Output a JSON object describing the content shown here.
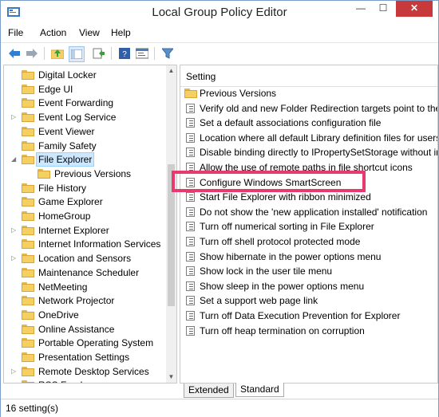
{
  "window": {
    "title": "Local Group Policy Editor",
    "minimize_glyph": "—",
    "maximize_glyph": "☐",
    "close_glyph": "✕"
  },
  "menu": [
    "File",
    "Action",
    "View",
    "Help"
  ],
  "toolbar": {
    "icons": [
      "back-arrow-icon",
      "forward-arrow-icon",
      "up-folder-icon",
      "show-hide-tree-icon",
      "export-list-icon",
      "help-icon",
      "properties-icon",
      "filter-icon"
    ]
  },
  "tree": {
    "items": [
      {
        "label": "Digital Locker",
        "expander": ""
      },
      {
        "label": "Edge UI",
        "expander": ""
      },
      {
        "label": "Event Forwarding",
        "expander": ""
      },
      {
        "label": "Event Log Service",
        "expander": "▷"
      },
      {
        "label": "Event Viewer",
        "expander": ""
      },
      {
        "label": "Family Safety",
        "expander": ""
      },
      {
        "label": "File Explorer",
        "expander": "◢",
        "selected": true
      },
      {
        "label": "Previous Versions",
        "expander": "",
        "indent": true
      },
      {
        "label": "File History",
        "expander": ""
      },
      {
        "label": "Game Explorer",
        "expander": ""
      },
      {
        "label": "HomeGroup",
        "expander": ""
      },
      {
        "label": "Internet Explorer",
        "expander": "▷"
      },
      {
        "label": "Internet Information Services",
        "expander": ""
      },
      {
        "label": "Location and Sensors",
        "expander": "▷"
      },
      {
        "label": "Maintenance Scheduler",
        "expander": ""
      },
      {
        "label": "NetMeeting",
        "expander": ""
      },
      {
        "label": "Network Projector",
        "expander": ""
      },
      {
        "label": "OneDrive",
        "expander": ""
      },
      {
        "label": "Online Assistance",
        "expander": ""
      },
      {
        "label": "Portable Operating System",
        "expander": ""
      },
      {
        "label": "Presentation Settings",
        "expander": ""
      },
      {
        "label": "Remote Desktop Services",
        "expander": "▷"
      },
      {
        "label": "RSS Feeds",
        "expander": ""
      }
    ],
    "scroll_up_glyph": "▲",
    "scroll_down_glyph": "▼"
  },
  "details": {
    "column_header": "Setting",
    "rows": [
      {
        "label": "Previous Versions",
        "type": "folder"
      },
      {
        "label": "Verify old and new Folder Redirection targets point to the",
        "type": "setting"
      },
      {
        "label": "Set a default associations configuration file",
        "type": "setting"
      },
      {
        "label": "Location where all default Library definition files for users",
        "type": "setting"
      },
      {
        "label": "Disable binding directly to IPropertySetStorage without in",
        "type": "setting"
      },
      {
        "label": "Allow the use of remote paths in file shortcut icons",
        "type": "setting"
      },
      {
        "label": "Configure Windows SmartScreen",
        "type": "setting",
        "highlighted": true
      },
      {
        "label": "Start File Explorer with ribbon minimized",
        "type": "setting"
      },
      {
        "label": "Do not show the 'new application installed' notification",
        "type": "setting"
      },
      {
        "label": "Turn off numerical sorting in File Explorer",
        "type": "setting"
      },
      {
        "label": "Turn off shell protocol protected mode",
        "type": "setting"
      },
      {
        "label": "Show hibernate in the power options menu",
        "type": "setting"
      },
      {
        "label": "Show lock in the user tile menu",
        "type": "setting"
      },
      {
        "label": "Show sleep in the power options menu",
        "type": "setting"
      },
      {
        "label": "Set a support web page link",
        "type": "setting"
      },
      {
        "label": "Turn off Data Execution Prevention for Explorer",
        "type": "setting"
      },
      {
        "label": "Turn off heap termination on corruption",
        "type": "setting"
      }
    ],
    "highlight_color": "#e83a6e"
  },
  "tabs": [
    "Extended",
    "Standard"
  ],
  "status": "16 setting(s)"
}
